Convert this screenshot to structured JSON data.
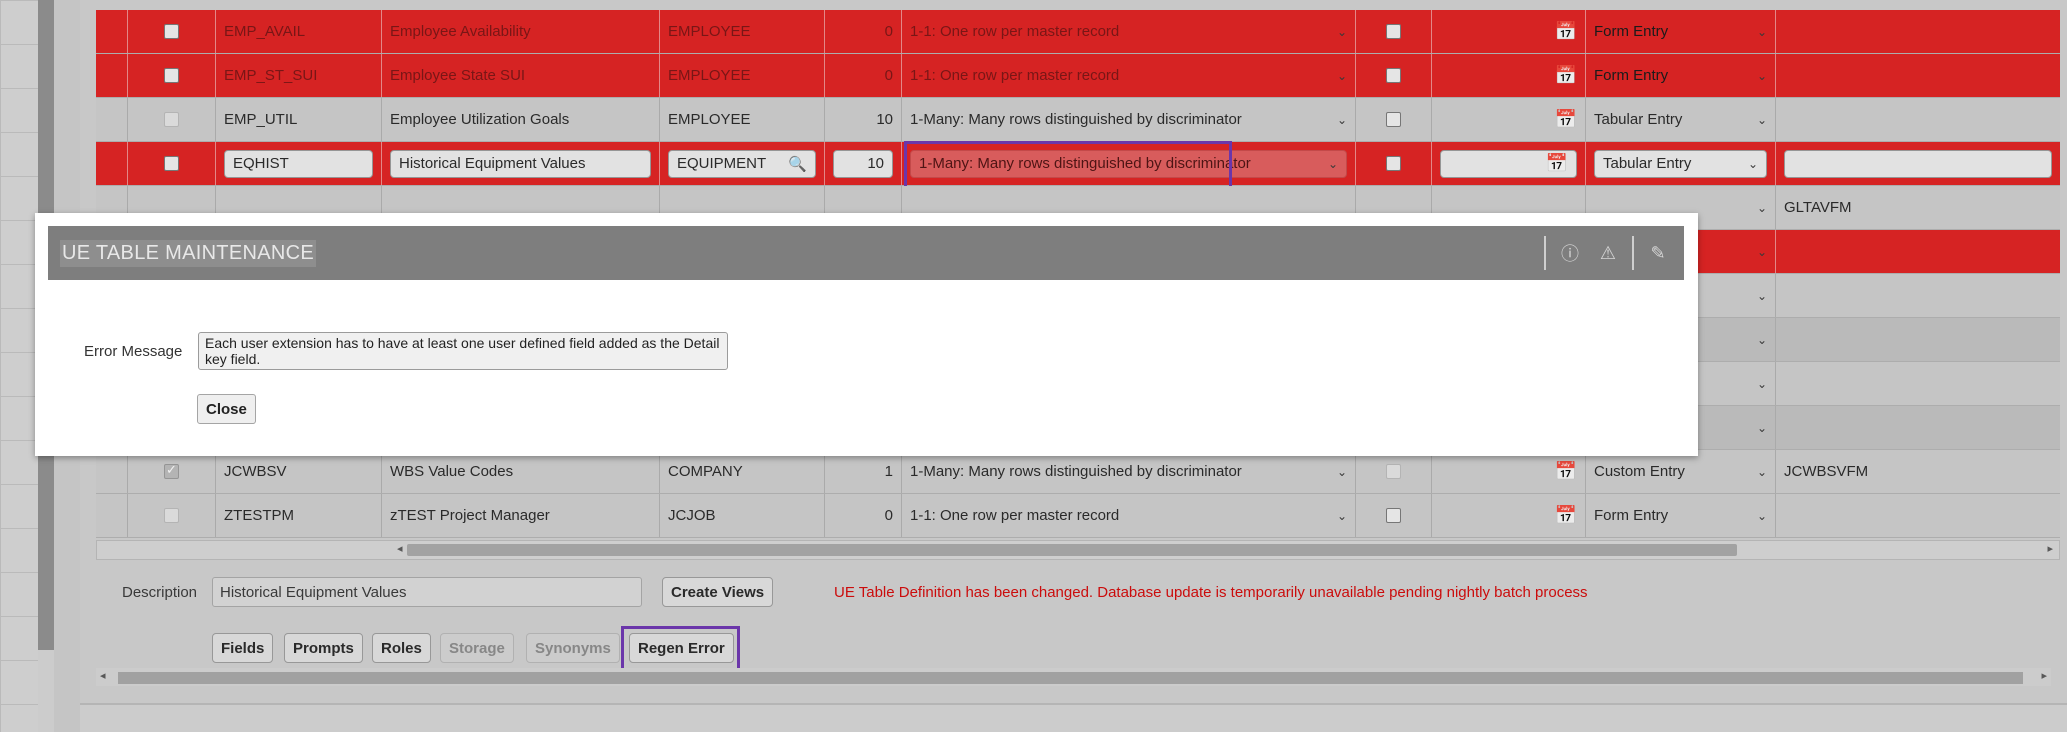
{
  "rows": [
    {
      "table": "EMP_AVAIL",
      "description": "Employee Availability",
      "master": "EMPLOYEE",
      "level": "0",
      "relationship": "1-1: One row per master record",
      "entry": "Form Entry",
      "view": ""
    },
    {
      "table": "EMP_ST_SUI",
      "description": "Employee State SUI",
      "master": "EMPLOYEE",
      "level": "0",
      "relationship": "1-1: One row per master record",
      "entry": "Form Entry",
      "view": ""
    },
    {
      "table": "EMP_UTIL",
      "description": "Employee Utilization Goals",
      "master": "EMPLOYEE",
      "level": "10",
      "relationship": "1-Many: Many rows distinguished by discriminator",
      "entry": "Tabular Entry",
      "view": ""
    },
    {
      "table": "EQHIST",
      "description": "Historical Equipment Values",
      "master": "EQUIPMENT",
      "level": "10",
      "relationship": "1-Many: Many rows distinguished by discriminator",
      "entry": "Tabular Entry",
      "view": ""
    },
    {
      "view": "GLTAVFM"
    },
    {
      "table": "JCWBSV",
      "description": "WBS Value Codes",
      "master": "COMPANY",
      "level": "1",
      "relationship": "1-Many: Many rows distinguished by discriminator",
      "entry": "Custom Entry",
      "view": "JCWBSVFM"
    },
    {
      "table": "ZTESTPM",
      "description": "zTEST Project Manager",
      "master": "JCJOB",
      "level": "0",
      "relationship": "1-1: One row per master record",
      "entry": "Form Entry",
      "view": ""
    }
  ],
  "footer": {
    "description_label": "Description",
    "description_value": "Historical Equipment Values",
    "create_views": "Create Views",
    "warning": "UE Table Definition has been changed. Database update is temporarily unavailable pending nightly batch process",
    "buttons": {
      "fields": "Fields",
      "prompts": "Prompts",
      "roles": "Roles",
      "storage": "Storage",
      "synonyms": "Synonyms",
      "regen_error": "Regen Error"
    }
  },
  "modal": {
    "title": "UE TABLE MAINTENANCE",
    "error_label": "Error Message",
    "error_text": "Each user extension has to have at least one user defined field added as the Detail key field.",
    "close": "Close"
  },
  "colors": {
    "row_red": "#e11a1a",
    "highlight": "#6a2fb0",
    "warning": "#d50000"
  }
}
